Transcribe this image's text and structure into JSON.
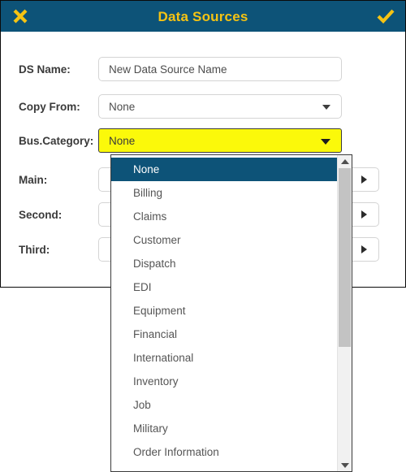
{
  "dialog": {
    "title": "Data Sources",
    "close_icon": "close-x-icon",
    "confirm_icon": "checkmark-icon"
  },
  "form": {
    "fields": [
      {
        "label": "DS Name:",
        "type": "text",
        "value": "New Data Source Name",
        "placeholder": "New Data Source Name"
      },
      {
        "label": "Copy From:",
        "type": "select",
        "value": "None"
      },
      {
        "label": "Bus.Category:",
        "type": "select",
        "value": "None",
        "highlight_color": "#fbf90a",
        "state": "open"
      },
      {
        "label": "Main:",
        "type": "select-with-button",
        "value": "",
        "button_icon": "play-arrow-icon"
      },
      {
        "label": "Second:",
        "type": "select-with-button",
        "value": "",
        "button_icon": "play-arrow-icon"
      },
      {
        "label": "Third:",
        "type": "select-with-button",
        "value": "",
        "button_icon": "play-arrow-icon"
      }
    ]
  },
  "dropdown": {
    "owner_field": "Bus.Category:",
    "selected": "None",
    "options": [
      "None",
      "Billing",
      "Claims",
      "Customer",
      "Dispatch",
      "EDI",
      "Equipment",
      "Financial",
      "International",
      "Inventory",
      "Job",
      "Military",
      "Order Information"
    ],
    "scrollbar": {
      "up_arrow_icon": "scroll-up-arrow-icon",
      "down_arrow_icon": "scroll-down-arrow-icon",
      "position": "top"
    }
  },
  "colors": {
    "header_background": "#0d5378",
    "header_text": "#f5c313",
    "highlight_select": "#fbf90a",
    "option_selected_background": "#0d5378",
    "label_text": "#3a3a3a"
  }
}
